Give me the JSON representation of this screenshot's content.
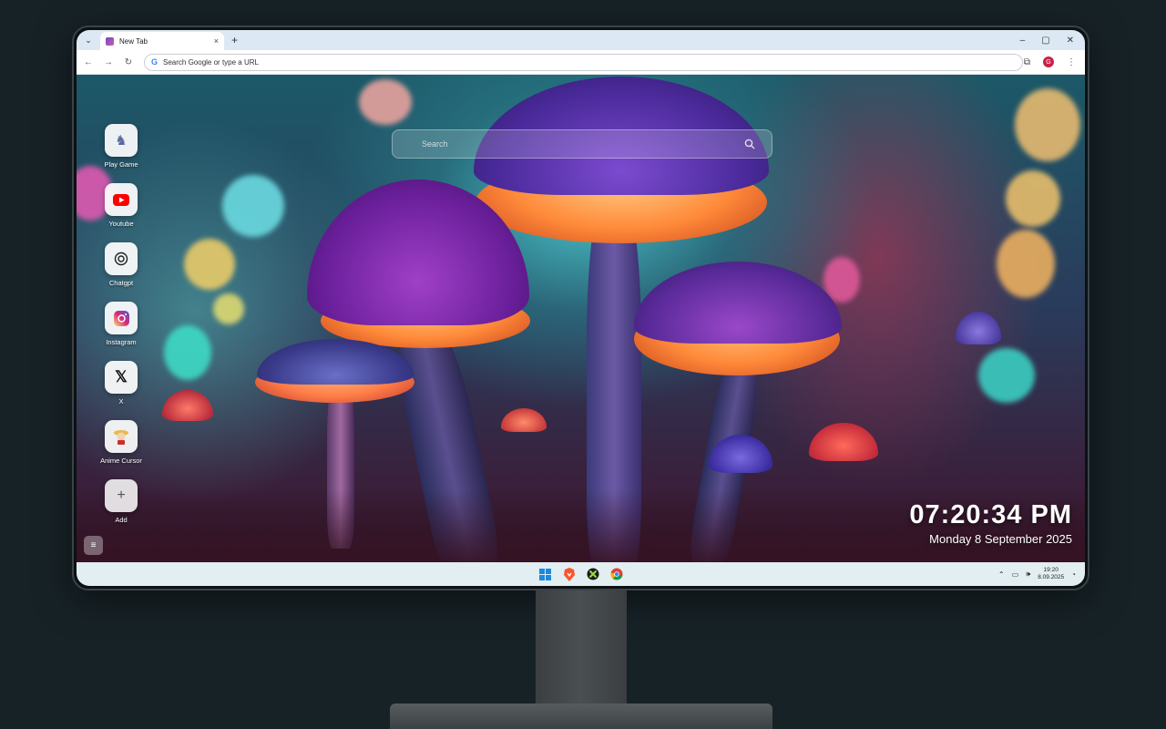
{
  "browser": {
    "tab_title": "New Tab",
    "tab_close": "×",
    "new_tab": "+",
    "omnibox_placeholder": "Search Google or type a URL",
    "profile_initial": "G",
    "window_controls": [
      "–",
      "▢",
      "✕"
    ]
  },
  "newtab": {
    "search_placeholder": "Search",
    "shortcuts": [
      {
        "label": "Play Game",
        "icon": "game-icon"
      },
      {
        "label": "Youtube",
        "icon": "youtube-icon"
      },
      {
        "label": "Chatgpt",
        "icon": "chatgpt-icon"
      },
      {
        "label": "Instagram",
        "icon": "instagram-icon"
      },
      {
        "label": "X",
        "icon": "x-icon"
      },
      {
        "label": "Anime Cursor",
        "icon": "anime-cursor-icon"
      },
      {
        "label": "Add",
        "icon": "plus-icon"
      }
    ],
    "clock_time": "07:20:34 PM",
    "clock_date": "Monday 8 September 2025"
  },
  "taskbar": {
    "apps": [
      "windows-start-icon",
      "brave-icon",
      "xbox-icon",
      "chrome-icon"
    ],
    "tray_time": "19:20",
    "tray_date": "8.09.2025"
  },
  "colors": {
    "accent": "#c7234b",
    "taskbar": "#e2eef1",
    "tabbar": "#dce8f3"
  }
}
